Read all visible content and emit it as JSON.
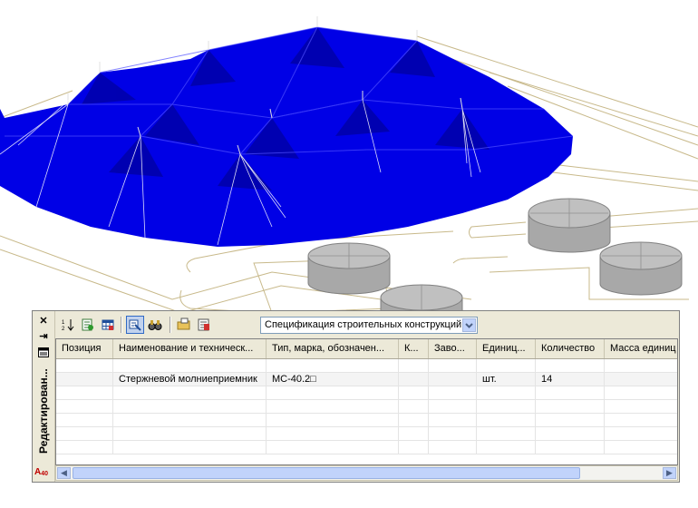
{
  "palette": {
    "side_title": "Редактирован...",
    "logo_text": "A",
    "combo_value": "Спецификация строительных конструкций",
    "columns": [
      "Позиция",
      "Наименование и техническ...",
      "Тип, марка, обозначен...",
      "К...",
      "Заво...",
      "Единиц...",
      "Количество",
      "Масса единиц"
    ],
    "row": {
      "name": "Стержневой молниеприемник",
      "type": "МС-40.2□",
      "unit": "шт.",
      "quantity": "14"
    }
  },
  "colors": {
    "mesh_blue": "#0000e6",
    "mesh_dark": "#0000a8",
    "line_olive": "#c8b98a",
    "tank_gray": "#a8a8a8"
  },
  "icons": [
    "sort-icon",
    "refresh-icon",
    "table-icon",
    "filter-icon",
    "binoculars-icon",
    "folder-icon",
    "export-icon",
    "close-icon",
    "auto-hide-icon",
    "properties-icon"
  ]
}
